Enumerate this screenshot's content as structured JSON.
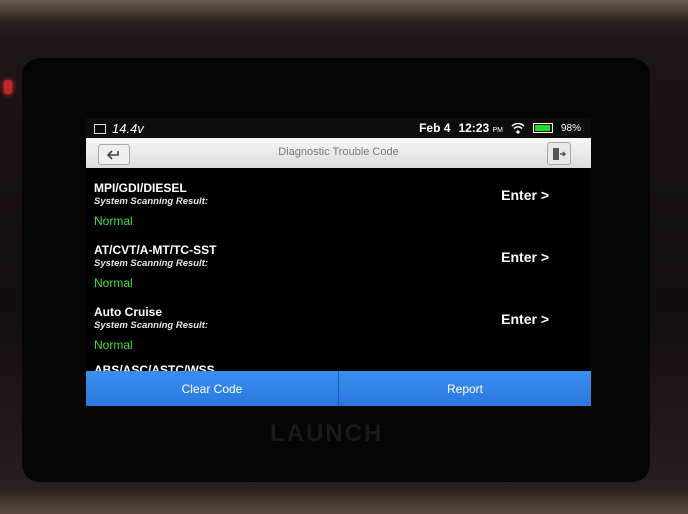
{
  "status_bar": {
    "voltage": "14.4v",
    "date": "Feb 4",
    "time": "12:23",
    "ampm": "PM",
    "battery": "98%"
  },
  "header": {
    "title": "Diagnostic Trouble Code",
    "back_icon": "back-arrow-icon",
    "exit_icon": "exit-icon"
  },
  "systems": [
    {
      "name": "MPI/GDI/DIESEL",
      "label": "System Scanning Result:",
      "status": "Normal",
      "enter": "Enter >"
    },
    {
      "name": "AT/CVT/A-MT/TC-SST",
      "label": "System Scanning Result:",
      "status": "Normal",
      "enter": "Enter >"
    },
    {
      "name": "Auto Cruise",
      "label": "System Scanning Result:",
      "status": "Normal",
      "enter": "Enter >"
    }
  ],
  "partial_system": "ABS/ASC/ASTC/WSS",
  "actions": {
    "clear_code": "Clear Code",
    "report": "Report"
  },
  "brand": "LAUNCH",
  "colors": {
    "normal_status": "#3ee03e",
    "button_blue": "#2f84e8"
  }
}
